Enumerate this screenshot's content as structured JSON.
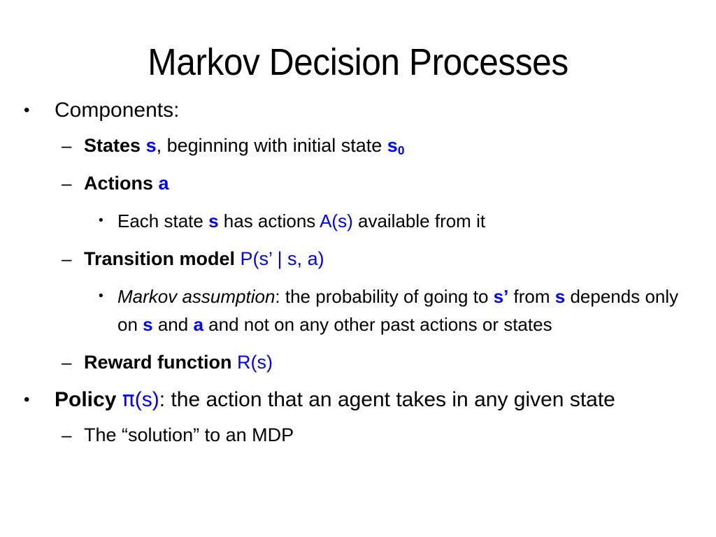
{
  "slide": {
    "title": "Markov Decision Processes",
    "background_color": "#ffffff",
    "text_color": "#000000",
    "accent_color": "#0000ff"
  },
  "bullets": {
    "level1_marker": "•",
    "level2_marker": "–",
    "level3_marker": "•"
  },
  "content": {
    "components_label": "Components:",
    "states_label": "States",
    "states_sym": "s",
    "states_mid": ", beginning with initial state ",
    "states_sym0": "s",
    "states_sym0_sub": "0",
    "actions_label": "Actions",
    "actions_sym": "a",
    "each_state_pre": "Each state ",
    "each_state_sym": "s",
    "each_state_mid": " has actions ",
    "each_state_as": "A(s)",
    "each_state_post": " available from it",
    "transition_label": "Transition model",
    "transition_formula": "P(s’ | s, a)",
    "markov_label": "Markov assumption",
    "markov_pre": ": the probability of going to ",
    "markov_sprime": "s’",
    "markov_mid1": " from ",
    "markov_s1": "s",
    "markov_mid2": " depends only on ",
    "markov_s2": "s",
    "markov_mid3": " and ",
    "markov_a": "a",
    "markov_post": " and not on any other past actions or states",
    "reward_label": "Reward function",
    "reward_formula": "R(s)",
    "policy_label": "Policy",
    "policy_formula_pi": "π",
    "policy_formula_rest": "(s)",
    "policy_text": ": the action that an agent takes in any given state",
    "solution_text": "The “solution” to an MDP"
  }
}
